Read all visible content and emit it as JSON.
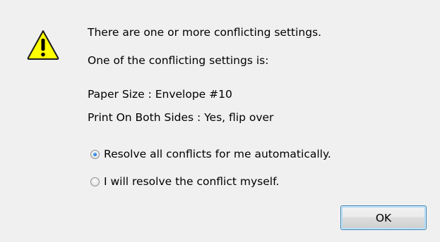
{
  "dialog": {
    "message_line1": "There are one or more conflicting settings.",
    "message_line2": "One of the conflicting settings is:",
    "setting1": "Paper Size : Envelope #10",
    "setting2": "Print On Both Sides : Yes, flip over",
    "icon": "warning-icon"
  },
  "options": [
    {
      "label": "Resolve all conflicts for me automatically.",
      "checked": true
    },
    {
      "label": "I will resolve the conflict myself.",
      "checked": false
    }
  ],
  "buttons": {
    "ok_label": "OK"
  },
  "colors": {
    "dialog_background": "#f0f0f0",
    "warning_fill": "#ffff00",
    "button_border": "#3c7fb1"
  }
}
